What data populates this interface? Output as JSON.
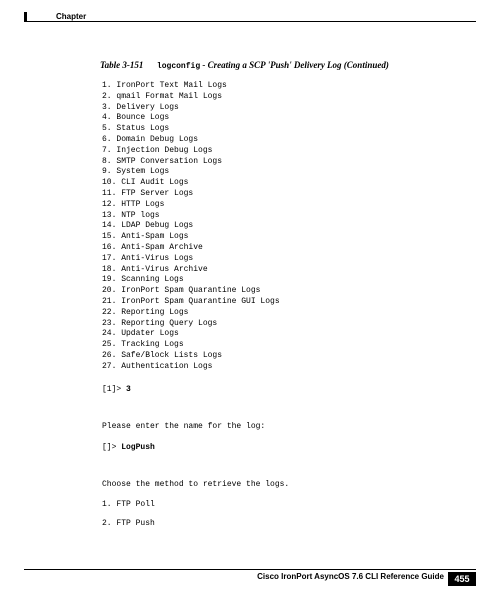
{
  "header": {
    "chapter_label": "Chapter"
  },
  "caption": {
    "table_label": "Table 3-151",
    "command": "logconfig",
    "separator": " - ",
    "title": "Creating a SCP 'Push' Delivery Log  (Continued)"
  },
  "log_types": [
    "1. IronPort Text Mail Logs",
    "2. qmail Format Mail Logs",
    "3. Delivery Logs",
    "4. Bounce Logs",
    "5. Status Logs",
    "6. Domain Debug Logs",
    "7. Injection Debug Logs",
    "8. SMTP Conversation Logs",
    "9. System Logs",
    "10. CLI Audit Logs",
    "11. FTP Server Logs",
    "12. HTTP Logs",
    "13. NTP logs",
    "14. LDAP Debug Logs",
    "15. Anti-Spam Logs",
    "16. Anti-Spam Archive",
    "17. Anti-Virus Logs",
    "18. Anti-Virus Archive",
    "19. Scanning Logs",
    "20. IronPort Spam Quarantine Logs",
    "21. IronPort Spam Quarantine GUI Logs",
    "22. Reporting Logs",
    "23. Reporting Query Logs",
    "24. Updater Logs",
    "25. Tracking Logs",
    "26. Safe/Block Lists Logs",
    "27. Authentication Logs"
  ],
  "prompts": {
    "p1_prefix": "[1]> ",
    "p1_input": "3",
    "p2_instruction": "Please enter the name for the log:",
    "p2_prefix": "[]> ",
    "p2_input": "LogPush",
    "p3_instruction": "Choose the method to retrieve the logs."
  },
  "methods": [
    "1. FTP Poll",
    "2. FTP Push"
  ],
  "footer": {
    "guide_title": "Cisco IronPort AsyncOS 7.6 CLI Reference Guide",
    "page_number": "455"
  }
}
